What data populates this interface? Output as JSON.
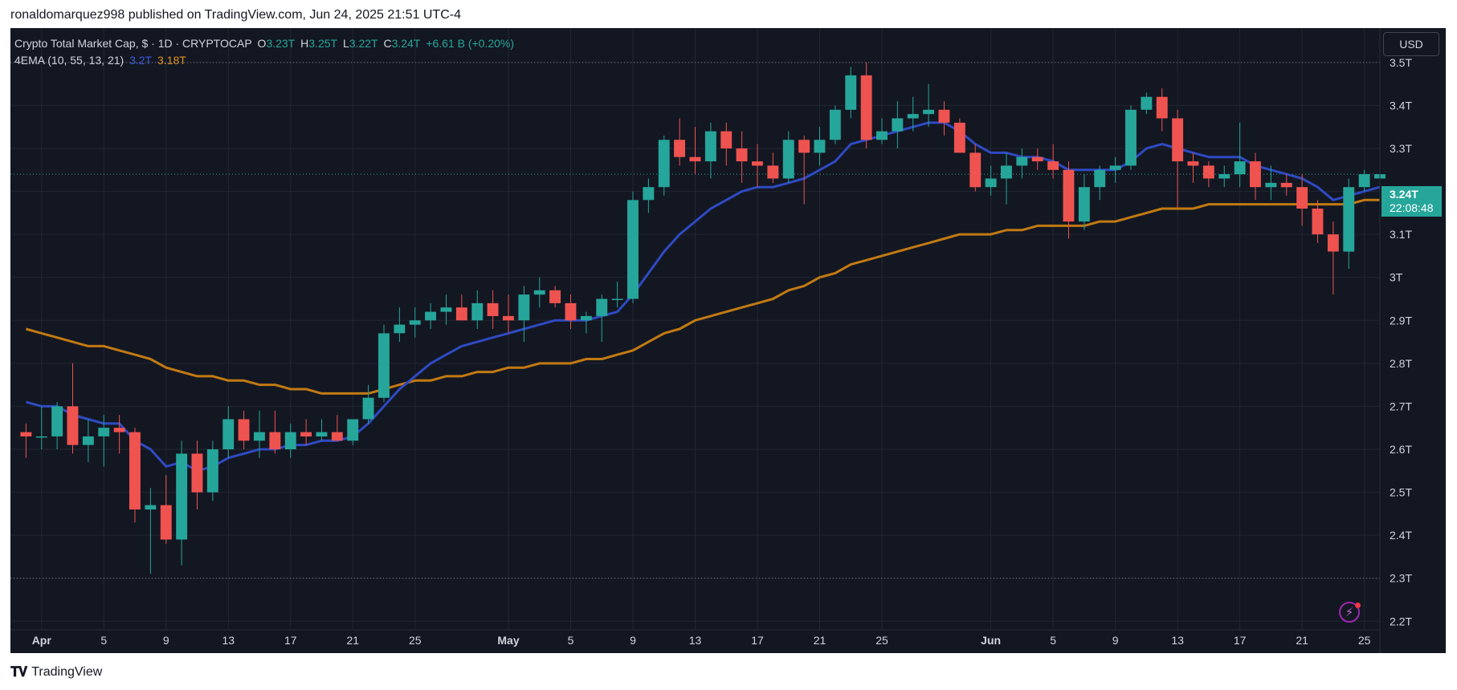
{
  "header": {
    "publisher": "ronaldomarquez998",
    "published_text": "published on TradingView.com, Jun 24, 2025 21:51 UTC-4"
  },
  "legend": {
    "symbol": "Crypto Total Market Cap, $ · 1D · CRYPTOCAP",
    "o_label": "O",
    "o_value": "3.23T",
    "h_label": "H",
    "h_value": "3.25T",
    "l_label": "L",
    "l_value": "3.22T",
    "c_label": "C",
    "c_value": "3.24T",
    "change": "+6.61 B (+0.20%)",
    "indicator": "4EMA (10, 55, 13, 21)",
    "ema_fast_value": "3.2T",
    "ema_slow_value": "3.18T"
  },
  "toolbar": {
    "currency": "USD"
  },
  "price_tag": {
    "price": "3.24T",
    "countdown": "22:08:48"
  },
  "footer": {
    "brand": "TradingView"
  },
  "colors": {
    "background": "#131722",
    "up": "#26a69a",
    "down": "#ef5350",
    "ema_fast": "#2f4ac2",
    "ema_slow": "#c27a12",
    "grid": "#232732",
    "axis_text": "#d1d4dc"
  },
  "icons": {
    "logo": "tradingview-logo-icon",
    "alert": "lightning-icon"
  },
  "chart_data": {
    "type": "candlestick",
    "x_start": "2025-03-31",
    "xlim": [
      "2025-03-30",
      "2025-06-26"
    ],
    "ylim": [
      2.18,
      3.58
    ],
    "yticks": [
      2.2,
      2.3,
      2.4,
      2.5,
      2.6,
      2.7,
      2.8,
      2.9,
      3.0,
      3.1,
      3.2,
      3.3,
      3.4,
      3.5
    ],
    "ytick_labels": [
      "2.2T",
      "2.3T",
      "2.4T",
      "2.5T",
      "2.6T",
      "2.7T",
      "2.8T",
      "2.9T",
      "3T",
      "3.1T",
      "3.2T",
      "3.3T",
      "3.4T",
      "3.5T"
    ],
    "xticks": [
      {
        "date": "2025-04-01",
        "label": "Apr"
      },
      {
        "date": "2025-04-05",
        "label": "5"
      },
      {
        "date": "2025-04-09",
        "label": "9"
      },
      {
        "date": "2025-04-13",
        "label": "13"
      },
      {
        "date": "2025-04-17",
        "label": "17"
      },
      {
        "date": "2025-04-21",
        "label": "21"
      },
      {
        "date": "2025-04-25",
        "label": "25"
      },
      {
        "date": "2025-05-01",
        "label": "May"
      },
      {
        "date": "2025-05-05",
        "label": "5"
      },
      {
        "date": "2025-05-09",
        "label": "9"
      },
      {
        "date": "2025-05-13",
        "label": "13"
      },
      {
        "date": "2025-05-17",
        "label": "17"
      },
      {
        "date": "2025-05-21",
        "label": "21"
      },
      {
        "date": "2025-05-25",
        "label": "25"
      },
      {
        "date": "2025-06-01",
        "label": "Jun"
      },
      {
        "date": "2025-06-05",
        "label": "5"
      },
      {
        "date": "2025-06-09",
        "label": "9"
      },
      {
        "date": "2025-06-13",
        "label": "13"
      },
      {
        "date": "2025-06-17",
        "label": "17"
      },
      {
        "date": "2025-06-21",
        "label": "21"
      },
      {
        "date": "2025-06-25",
        "label": "25"
      }
    ],
    "candles": [
      [
        2.64,
        2.66,
        2.58,
        2.63
      ],
      [
        2.63,
        2.7,
        2.6,
        2.63
      ],
      [
        2.63,
        2.71,
        2.6,
        2.7
      ],
      [
        2.7,
        2.8,
        2.59,
        2.61
      ],
      [
        2.61,
        2.67,
        2.57,
        2.63
      ],
      [
        2.63,
        2.68,
        2.56,
        2.65
      ],
      [
        2.65,
        2.68,
        2.59,
        2.64
      ],
      [
        2.64,
        2.65,
        2.43,
        2.46
      ],
      [
        2.46,
        2.51,
        2.31,
        2.47
      ],
      [
        2.47,
        2.54,
        2.38,
        2.39
      ],
      [
        2.39,
        2.62,
        2.33,
        2.59
      ],
      [
        2.59,
        2.62,
        2.46,
        2.5
      ],
      [
        2.5,
        2.62,
        2.48,
        2.6
      ],
      [
        2.6,
        2.7,
        2.58,
        2.67
      ],
      [
        2.67,
        2.69,
        2.6,
        2.62
      ],
      [
        2.62,
        2.69,
        2.58,
        2.64
      ],
      [
        2.64,
        2.69,
        2.59,
        2.6
      ],
      [
        2.6,
        2.66,
        2.58,
        2.64
      ],
      [
        2.64,
        2.67,
        2.61,
        2.63
      ],
      [
        2.63,
        2.67,
        2.62,
        2.64
      ],
      [
        2.64,
        2.68,
        2.62,
        2.62
      ],
      [
        2.62,
        2.66,
        2.61,
        2.67
      ],
      [
        2.67,
        2.75,
        2.66,
        2.72
      ],
      [
        2.72,
        2.89,
        2.71,
        2.87
      ],
      [
        2.87,
        2.93,
        2.85,
        2.89
      ],
      [
        2.89,
        2.93,
        2.86,
        2.9
      ],
      [
        2.9,
        2.94,
        2.88,
        2.92
      ],
      [
        2.92,
        2.96,
        2.89,
        2.93
      ],
      [
        2.93,
        2.96,
        2.9,
        2.9
      ],
      [
        2.9,
        2.97,
        2.88,
        2.94
      ],
      [
        2.94,
        2.97,
        2.88,
        2.91
      ],
      [
        2.91,
        2.96,
        2.87,
        2.9
      ],
      [
        2.9,
        2.98,
        2.85,
        2.96
      ],
      [
        2.96,
        3.0,
        2.93,
        2.97
      ],
      [
        2.97,
        2.98,
        2.93,
        2.94
      ],
      [
        2.94,
        2.96,
        2.88,
        2.9
      ],
      [
        2.9,
        2.92,
        2.87,
        2.91
      ],
      [
        2.91,
        2.96,
        2.85,
        2.95
      ],
      [
        2.95,
        2.99,
        2.93,
        2.95
      ],
      [
        2.95,
        3.2,
        2.94,
        3.18
      ],
      [
        3.18,
        3.23,
        3.15,
        3.21
      ],
      [
        3.21,
        3.33,
        3.19,
        3.32
      ],
      [
        3.32,
        3.37,
        3.26,
        3.28
      ],
      [
        3.28,
        3.35,
        3.24,
        3.27
      ],
      [
        3.27,
        3.36,
        3.23,
        3.34
      ],
      [
        3.34,
        3.36,
        3.26,
        3.3
      ],
      [
        3.3,
        3.34,
        3.22,
        3.27
      ],
      [
        3.27,
        3.31,
        3.21,
        3.26
      ],
      [
        3.26,
        3.29,
        3.22,
        3.23
      ],
      [
        3.23,
        3.34,
        3.22,
        3.32
      ],
      [
        3.32,
        3.33,
        3.17,
        3.29
      ],
      [
        3.29,
        3.35,
        3.26,
        3.32
      ],
      [
        3.32,
        3.4,
        3.31,
        3.39
      ],
      [
        3.39,
        3.49,
        3.37,
        3.47
      ],
      [
        3.47,
        3.5,
        3.3,
        3.32
      ],
      [
        3.32,
        3.37,
        3.31,
        3.34
      ],
      [
        3.34,
        3.41,
        3.3,
        3.37
      ],
      [
        3.37,
        3.42,
        3.34,
        3.38
      ],
      [
        3.38,
        3.45,
        3.35,
        3.39
      ],
      [
        3.39,
        3.41,
        3.33,
        3.36
      ],
      [
        3.36,
        3.37,
        3.29,
        3.29
      ],
      [
        3.29,
        3.31,
        3.2,
        3.21
      ],
      [
        3.21,
        3.26,
        3.19,
        3.23
      ],
      [
        3.23,
        3.29,
        3.17,
        3.26
      ],
      [
        3.26,
        3.3,
        3.23,
        3.28
      ],
      [
        3.28,
        3.3,
        3.25,
        3.27
      ],
      [
        3.27,
        3.31,
        3.23,
        3.25
      ],
      [
        3.25,
        3.27,
        3.09,
        3.13
      ],
      [
        3.13,
        3.24,
        3.11,
        3.21
      ],
      [
        3.21,
        3.26,
        3.18,
        3.25
      ],
      [
        3.25,
        3.28,
        3.22,
        3.26
      ],
      [
        3.26,
        3.4,
        3.25,
        3.39
      ],
      [
        3.39,
        3.43,
        3.38,
        3.42
      ],
      [
        3.42,
        3.44,
        3.34,
        3.37
      ],
      [
        3.37,
        3.39,
        3.16,
        3.27
      ],
      [
        3.27,
        3.29,
        3.22,
        3.26
      ],
      [
        3.26,
        3.27,
        3.21,
        3.23
      ],
      [
        3.23,
        3.26,
        3.21,
        3.24
      ],
      [
        3.24,
        3.36,
        3.21,
        3.27
      ],
      [
        3.27,
        3.29,
        3.18,
        3.21
      ],
      [
        3.21,
        3.26,
        3.18,
        3.22
      ],
      [
        3.22,
        3.24,
        3.19,
        3.21
      ],
      [
        3.21,
        3.24,
        3.12,
        3.16
      ],
      [
        3.16,
        3.18,
        3.08,
        3.1
      ],
      [
        3.1,
        3.13,
        2.96,
        3.06
      ],
      [
        3.06,
        3.23,
        3.02,
        3.21
      ],
      [
        3.21,
        3.25,
        3.2,
        3.24
      ],
      [
        3.23,
        3.25,
        3.22,
        3.24
      ]
    ],
    "ema_fast": [
      2.71,
      2.7,
      2.7,
      2.68,
      2.67,
      2.66,
      2.66,
      2.62,
      2.6,
      2.56,
      2.57,
      2.55,
      2.56,
      2.58,
      2.59,
      2.6,
      2.6,
      2.61,
      2.61,
      2.62,
      2.62,
      2.63,
      2.66,
      2.7,
      2.74,
      2.77,
      2.8,
      2.82,
      2.84,
      2.85,
      2.86,
      2.87,
      2.88,
      2.89,
      2.9,
      2.9,
      2.9,
      2.91,
      2.92,
      2.96,
      3.01,
      3.06,
      3.1,
      3.13,
      3.16,
      3.18,
      3.2,
      3.21,
      3.21,
      3.22,
      3.23,
      3.25,
      3.27,
      3.31,
      3.32,
      3.33,
      3.34,
      3.35,
      3.36,
      3.36,
      3.34,
      3.31,
      3.29,
      3.29,
      3.28,
      3.28,
      3.27,
      3.25,
      3.25,
      3.25,
      3.25,
      3.27,
      3.3,
      3.31,
      3.3,
      3.29,
      3.28,
      3.28,
      3.28,
      3.26,
      3.25,
      3.24,
      3.23,
      3.21,
      3.18,
      3.19,
      3.2,
      3.21
    ],
    "ema_slow": [
      2.88,
      2.87,
      2.86,
      2.85,
      2.84,
      2.84,
      2.83,
      2.82,
      2.81,
      2.79,
      2.78,
      2.77,
      2.77,
      2.76,
      2.76,
      2.75,
      2.75,
      2.74,
      2.74,
      2.73,
      2.73,
      2.73,
      2.73,
      2.74,
      2.75,
      2.76,
      2.76,
      2.77,
      2.77,
      2.78,
      2.78,
      2.79,
      2.79,
      2.8,
      2.8,
      2.8,
      2.81,
      2.81,
      2.82,
      2.83,
      2.85,
      2.87,
      2.88,
      2.9,
      2.91,
      2.92,
      2.93,
      2.94,
      2.95,
      2.97,
      2.98,
      3.0,
      3.01,
      3.03,
      3.04,
      3.05,
      3.06,
      3.07,
      3.08,
      3.09,
      3.1,
      3.1,
      3.1,
      3.11,
      3.11,
      3.12,
      3.12,
      3.12,
      3.12,
      3.13,
      3.13,
      3.14,
      3.15,
      3.16,
      3.16,
      3.16,
      3.17,
      3.17,
      3.17,
      3.17,
      3.17,
      3.17,
      3.17,
      3.17,
      3.17,
      3.17,
      3.18,
      3.18
    ],
    "last_price": 3.24,
    "dotted_levels": [
      3.5,
      2.3
    ]
  }
}
